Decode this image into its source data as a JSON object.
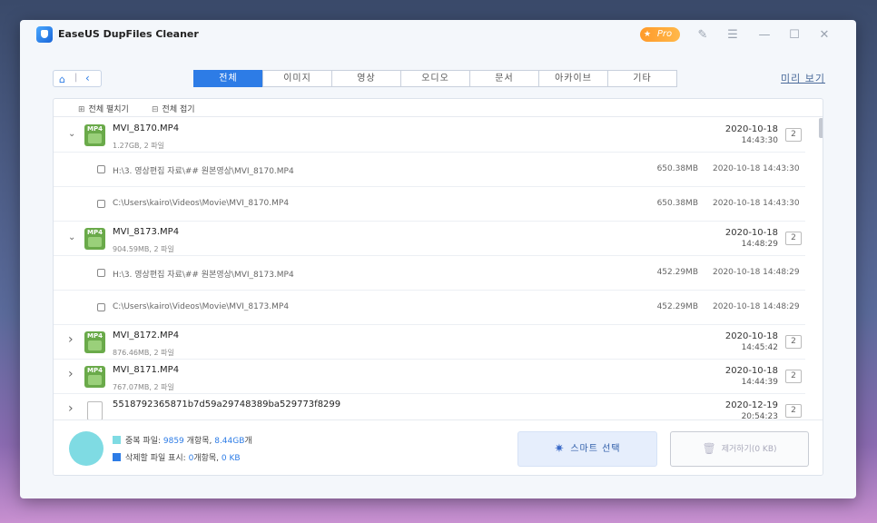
{
  "app": {
    "title": "EaseUS DupFiles Cleaner",
    "pro_label": "Pro"
  },
  "tabs": [
    {
      "label": "전체",
      "active": true
    },
    {
      "label": "이미지",
      "active": false
    },
    {
      "label": "영상",
      "active": false
    },
    {
      "label": "오디오",
      "active": false
    },
    {
      "label": "문서",
      "active": false
    },
    {
      "label": "아카이브",
      "active": false
    },
    {
      "label": "기타",
      "active": false
    }
  ],
  "preview_link": "미리 보기",
  "toolbar": {
    "expand_all": "전체 펼치기",
    "collapse_all": "전체 접기"
  },
  "groups": [
    {
      "name": "MVI_8170.MP4",
      "info": "1.27GB, 2 파일",
      "date": "2020-10-18",
      "time": "14:43:30",
      "count": "2",
      "expanded": true,
      "icon": "MP4",
      "children": [
        {
          "path": "H:\\3. 영상편집 자료\\## 원본영상\\MVI_8170.MP4",
          "size": "650.38MB",
          "date": "2020-10-18 14:43:30"
        },
        {
          "path": "C:\\Users\\kairo\\Videos\\Movie\\MVI_8170.MP4",
          "size": "650.38MB",
          "date": "2020-10-18 14:43:30"
        }
      ]
    },
    {
      "name": "MVI_8173.MP4",
      "info": "904.59MB, 2 파일",
      "date": "2020-10-18",
      "time": "14:48:29",
      "count": "2",
      "expanded": true,
      "icon": "MP4",
      "children": [
        {
          "path": "H:\\3. 영상편집 자료\\## 원본영상\\MVI_8173.MP4",
          "size": "452.29MB",
          "date": "2020-10-18 14:48:29"
        },
        {
          "path": "C:\\Users\\kairo\\Videos\\Movie\\MVI_8173.MP4",
          "size": "452.29MB",
          "date": "2020-10-18 14:48:29"
        }
      ]
    },
    {
      "name": "MVI_8172.MP4",
      "info": "876.46MB, 2 파일",
      "date": "2020-10-18",
      "time": "14:45:42",
      "count": "2",
      "expanded": false,
      "icon": "MP4",
      "children": []
    },
    {
      "name": "MVI_8171.MP4",
      "info": "767.07MB, 2 파일",
      "date": "2020-10-18",
      "time": "14:44:39",
      "count": "2",
      "expanded": false,
      "icon": "MP4",
      "children": []
    },
    {
      "name": "5518792365871b7d59a29748389ba529773f8299",
      "info": "",
      "date": "2020-12-19",
      "time": "20:54:23",
      "count": "2",
      "expanded": false,
      "icon": "doc",
      "children": []
    }
  ],
  "summary": {
    "dup_label": "중복 파일: ",
    "dup_count": "9859",
    "dup_unit": " 개항목, ",
    "dup_size": "8.44GB",
    "dup_suffix": "개",
    "del_label": "삭제할 파일 표시: ",
    "del_count": "0",
    "del_unit": "개항목, ",
    "del_size": "0 KB",
    "dup_color": "#7fdbe3",
    "del_color": "#2d7ce6"
  },
  "buttons": {
    "smart_select": "스마트 선택",
    "remove": "제거하기(0 KB)"
  },
  "colors": {
    "accent": "#2d7ce6",
    "pro": "#ff9a2a"
  }
}
